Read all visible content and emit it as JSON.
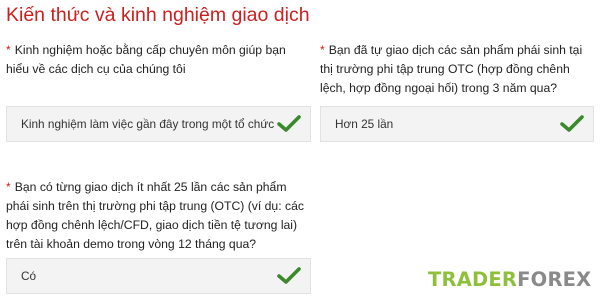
{
  "page": {
    "title": "Kiến thức và kinh nghiệm giao dịch"
  },
  "questions": [
    {
      "required_mark": "*",
      "text": "Kinh nghiệm hoặc bằng cấp chuyên môn giúp bạn hiểu về các dịch cụ của chúng tôi",
      "selected_value": "Kinh nghiệm làm việc gần đây trong một tổ chức tài c"
    },
    {
      "required_mark": "*",
      "text": "Bạn đã tự giao dịch các sản phẩm phái sinh tại thị trường phi tập trung OTC (hợp đồng chênh lệch, hợp đồng ngoại hối) trong 3 năm qua?",
      "selected_value": "Hơn 25 lần"
    },
    {
      "required_mark": "*",
      "text": "Bạn có từng giao dịch ít nhất 25 lần các sản phẩm phái sinh trên thị trường phi tập trung (OTC) (ví dụ: các hợp đồng chênh lệch/CFD, giao dịch tiền tệ tương lai) trên tài khoản demo trong vòng 12 tháng qua?",
      "selected_value": "Có"
    }
  ],
  "icons": {
    "valid": "check-icon"
  },
  "colors": {
    "title": "#cc1f1f",
    "required": "#cc1f1f",
    "check": "#3a8a2c",
    "logo_trader": "#8fc03c",
    "logo_forex": "#8a8a8a",
    "select_bg": "#f3f3f3"
  },
  "watermark": {
    "part1": "TRADER",
    "part2": "FOREX"
  }
}
